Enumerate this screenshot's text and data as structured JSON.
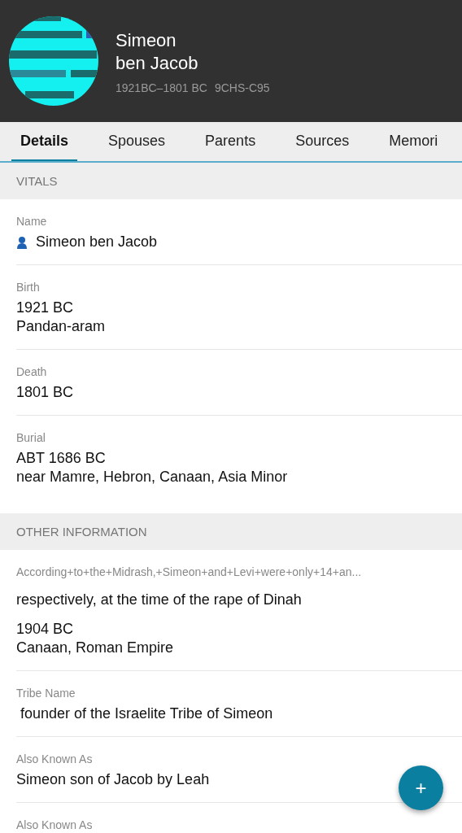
{
  "person": {
    "given_name": "Simeon",
    "surname": "ben Jacob",
    "lifespan": "1921BC–1801 BC",
    "id": "9CHS-C95"
  },
  "tabs": [
    {
      "label": "Details",
      "selected": true
    },
    {
      "label": "Spouses",
      "selected": false
    },
    {
      "label": "Parents",
      "selected": false
    },
    {
      "label": "Sources",
      "selected": false
    },
    {
      "label": "Memori",
      "selected": false
    }
  ],
  "sections": [
    {
      "title": "VITALS",
      "items": [
        {
          "kind": "name",
          "label": "Name",
          "values": [
            "Simeon ben Jacob"
          ]
        },
        {
          "kind": "fact",
          "label": "Birth",
          "values": [
            "1921 BC",
            "Pandan-aram"
          ]
        },
        {
          "kind": "fact",
          "label": "Death",
          "values": [
            "1801 BC"
          ]
        },
        {
          "kind": "fact",
          "label": "Burial",
          "values": [
            "ABT 1686 BC",
            "near Mamre, Hebron, Canaan, Asia Minor"
          ]
        }
      ]
    },
    {
      "title": "OTHER INFORMATION",
      "items": [
        {
          "kind": "fact",
          "label": "According+to+the+Midrash,+Simeon+and+Levi+were+only+14+an...",
          "note": "respectively, at the time of the rape of Dinah",
          "values": [
            "1904 BC",
            "Canaan, Roman Empire"
          ]
        },
        {
          "kind": "fact",
          "label": "Tribe Name",
          "values": [
            " founder of the Israelite Tribe of Simeon"
          ]
        },
        {
          "kind": "fact",
          "label": "Also Known As",
          "values": [
            "Simeon son of Jacob by Leah"
          ]
        },
        {
          "kind": "fact",
          "label": "Also Known As"
        }
      ]
    }
  ],
  "add_button": {
    "label": "+"
  }
}
